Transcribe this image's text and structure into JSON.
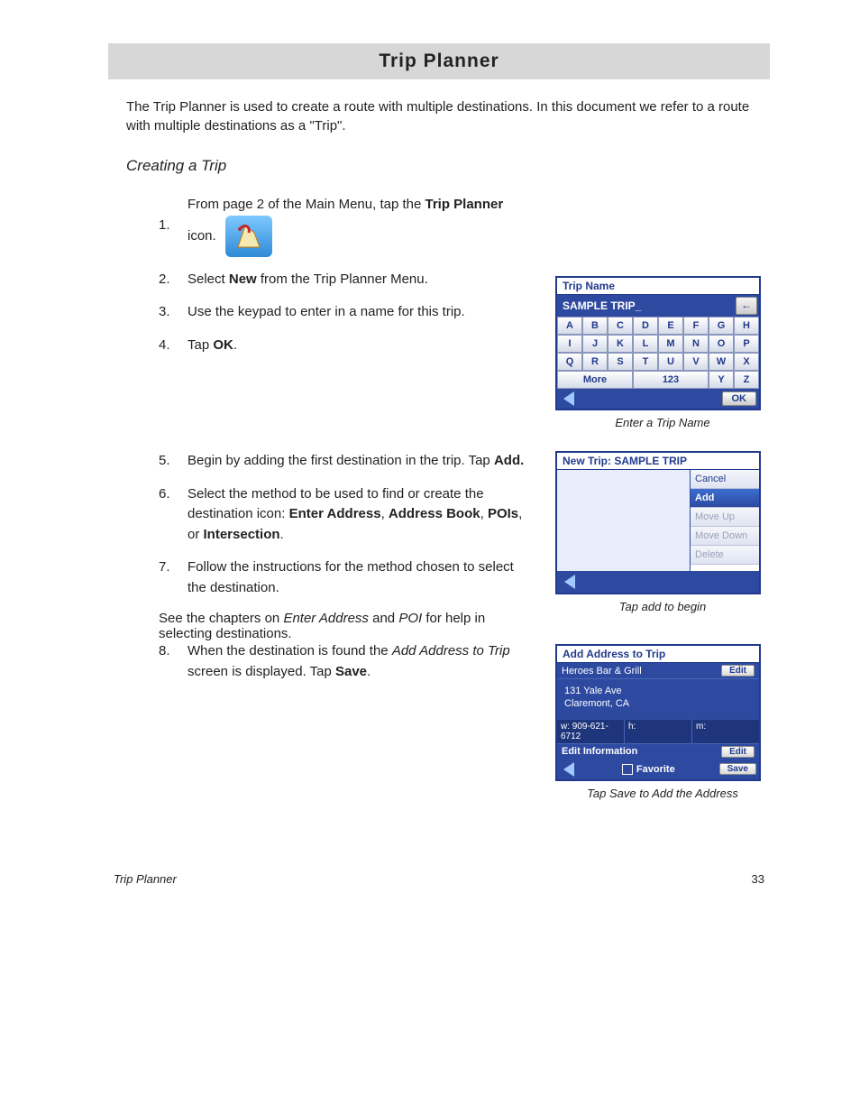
{
  "page_title": "Trip Planner",
  "intro": "The Trip Planner is used to create a route with multiple destinations.  In this document we refer to a route with multiple destinations as a \"Trip\".",
  "subheading": "Creating a Trip",
  "steps": {
    "s1_a": "From page 2 of the Main Menu, tap the ",
    "s1_b": "Trip Planner",
    "s1_c": " icon.",
    "s2_a": "Select ",
    "s2_b": "New",
    "s2_c": " from the Trip Planner Menu.",
    "s3": "Use the keypad to enter in a name for this trip.",
    "s4_a": "Tap ",
    "s4_b": "OK",
    "s4_c": ".",
    "s5_a": "Begin by adding the first destination in the trip.  Tap ",
    "s5_b": "Add.",
    "s6_a": "Select the method to be used to find or create the destination icon: ",
    "s6_b": "Enter Address",
    "s6_c": ", ",
    "s6_d": "Address Book",
    "s6_e": ", ",
    "s6_f": "POIs",
    "s6_g": ", or ",
    "s6_h": "Intersection",
    "s6_i": ".",
    "s7": "Follow the instructions for the method chosen to select the destination.",
    "s7_extra_a": "See the chapters on ",
    "s7_extra_b": "Enter Address",
    "s7_extra_c": " and ",
    "s7_extra_d": "POI",
    "s7_extra_e": " for help in selecting destinations.",
    "s8_a": "When the destination is found the ",
    "s8_b": "Add Address to Trip",
    "s8_c": " screen is displayed.  Tap ",
    "s8_d": "Save",
    "s8_e": "."
  },
  "nums": {
    "n1": "1.",
    "n2": "2.",
    "n3": "3.",
    "n4": "4.",
    "n5": "5.",
    "n6": "6.",
    "n7": "7.",
    "n8": "8."
  },
  "keypad_screen": {
    "title": "Trip Name",
    "input_value": "SAMPLE TRIP_",
    "back_arrow": "←",
    "keys_row1": [
      "A",
      "B",
      "C",
      "D",
      "E",
      "F",
      "G",
      "H"
    ],
    "keys_row2": [
      "I",
      "J",
      "K",
      "L",
      "M",
      "N",
      "O",
      "P"
    ],
    "keys_row3": [
      "Q",
      "R",
      "S",
      "T",
      "U",
      "V",
      "W",
      "X"
    ],
    "more": "More",
    "num": "123",
    "Y": "Y",
    "Z": "Z",
    "ok": "OK",
    "caption": "Enter a Trip Name"
  },
  "newtrip_screen": {
    "title": "New Trip: SAMPLE TRIP",
    "btn_cancel": "Cancel",
    "btn_add": "Add",
    "btn_up": "Move Up",
    "btn_down": "Move Down",
    "btn_delete": "Delete",
    "caption": "Tap add to begin"
  },
  "addaddr_screen": {
    "title": "Add Address to Trip",
    "place": "Heroes Bar & Grill",
    "edit": "Edit",
    "addr1": "131 Yale Ave",
    "addr2": "Claremont, CA",
    "phone_w_lbl": "w:",
    "phone_w": "909-621-6712",
    "phone_h_lbl": "h:",
    "phone_m_lbl": "m:",
    "edit_info": "Edit Information",
    "favorite": "Favorite",
    "save": "Save",
    "caption": "Tap Save to Add the Address"
  },
  "footer": {
    "label": "Trip Planner",
    "page": "33"
  }
}
